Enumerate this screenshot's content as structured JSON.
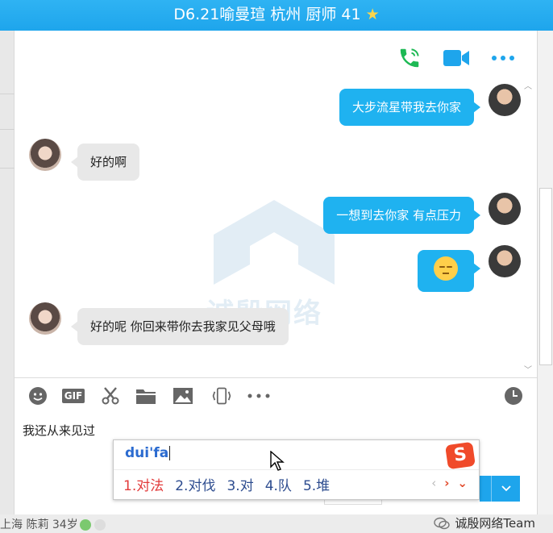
{
  "window": {
    "title": "D6.21喻曼瑄 杭州 厨师 41",
    "title_star": "★"
  },
  "chat_header": {
    "icons": [
      "phone-icon",
      "video-call-icon",
      "more-icon"
    ],
    "colors": {
      "phone": "#1db954",
      "video": "#1ea5ec",
      "more": "#1ea5ec"
    }
  },
  "messages": [
    {
      "sender": "me",
      "text": "大步流星带我去你家"
    },
    {
      "sender": "her",
      "text": "好的啊"
    },
    {
      "sender": "me",
      "text": "一想到去你家   有点压力"
    },
    {
      "sender": "me",
      "emoji": "sleeping-face-emoji"
    },
    {
      "sender": "her",
      "text": "好的呢  你回来带你去我家见父母哦"
    }
  ],
  "watermark": {
    "text": "诚殷网络"
  },
  "toolbar": {
    "gif_label": "GIF",
    "icons": [
      "emoji-icon",
      "gif-icon",
      "scissors-icon",
      "folder-icon",
      "image-icon",
      "screen-shake-icon",
      "more-tools-icon",
      "history-clock-icon"
    ]
  },
  "input": {
    "text": "我还从来见过"
  },
  "ime": {
    "composition": "dui'fa",
    "candidates": [
      "1.对法",
      "2.对伐",
      "3.对",
      "4.队",
      "5.堆"
    ],
    "nav": {
      "prev": "‹",
      "next": "›",
      "expand": "⌄"
    },
    "logo": "S"
  },
  "footer": {
    "contact": "上海 陈莉 34岁",
    "team": "诚殷网络Team"
  },
  "colors": {
    "accent": "#1ea5ec",
    "bubble_out": "#1fb2f0",
    "bubble_in": "#e8e8e8",
    "candidate_first": "#e23a3a"
  }
}
